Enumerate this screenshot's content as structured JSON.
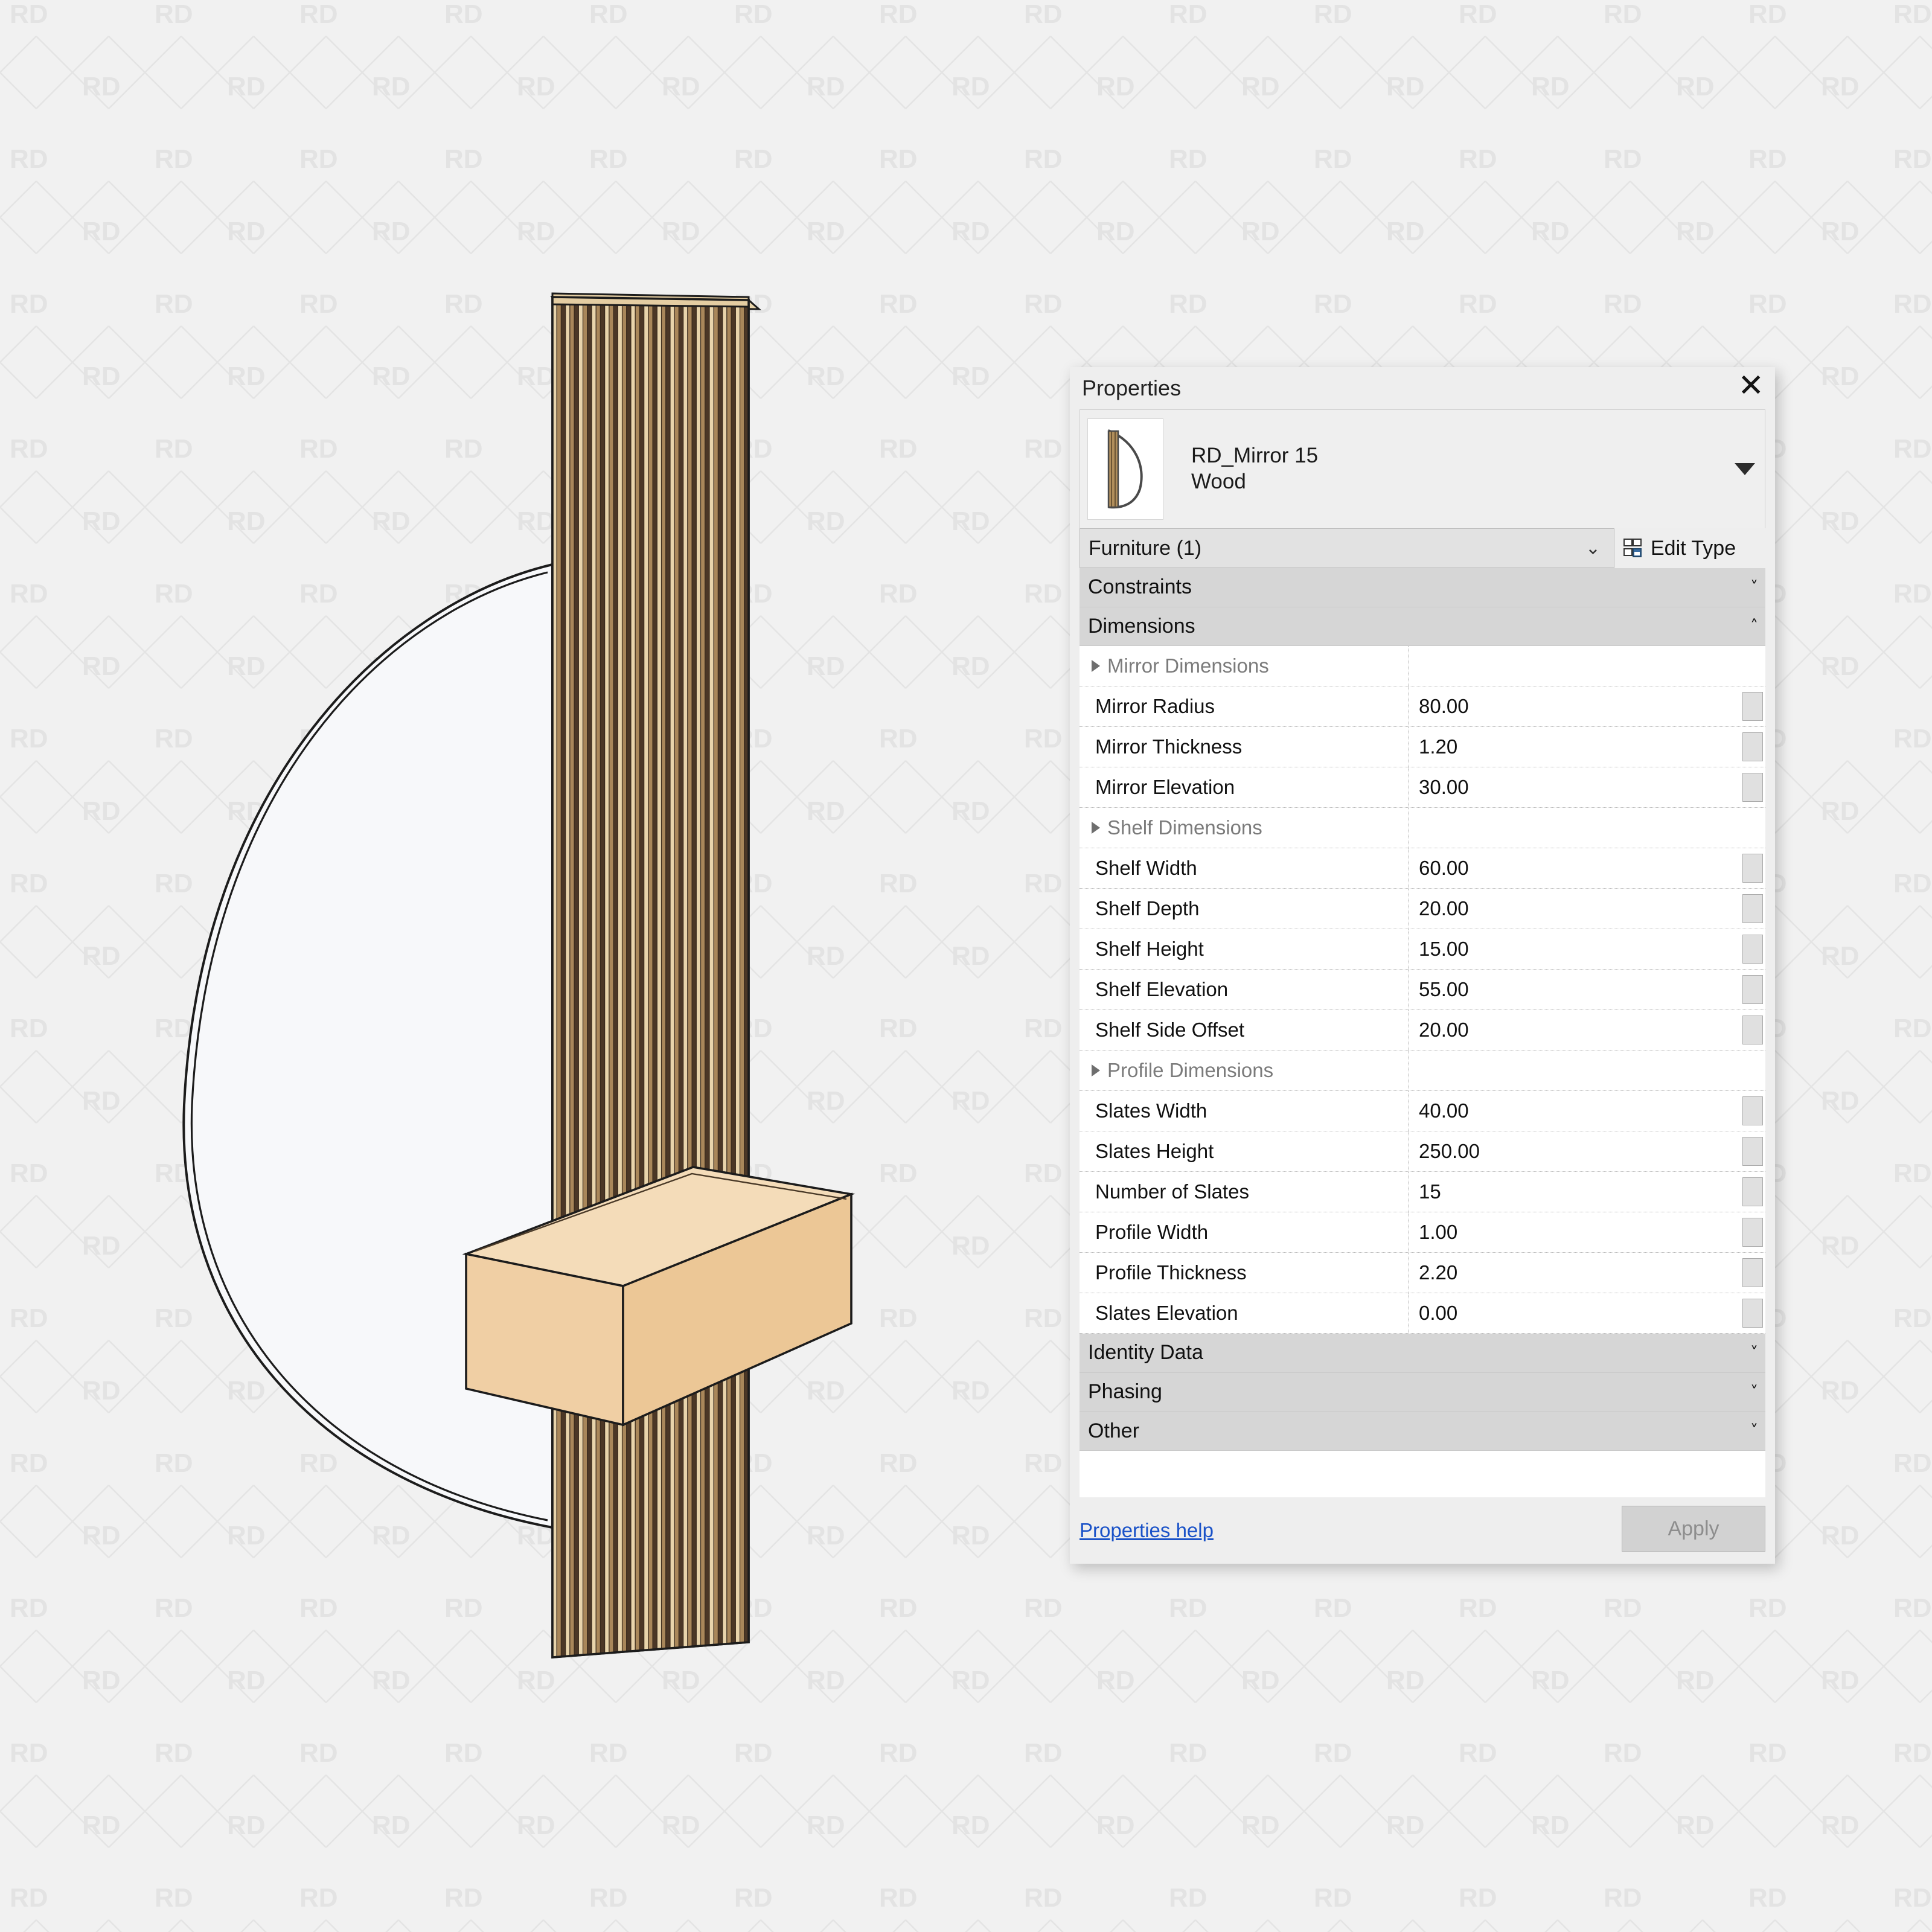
{
  "watermark": {
    "text": "RD"
  },
  "palette": {
    "title": "Properties",
    "close_icon": "close-icon",
    "type_name_line1": "RD_Mirror 15",
    "type_name_line2": "Wood",
    "family_selector_value": "Furniture (1)",
    "edit_type_label": "Edit Type",
    "edit_type_icon": "edit-type-icon",
    "sections": [
      {
        "label": "Constraints",
        "state": "collapsed",
        "chevron": "chevron-double-down-icon"
      },
      {
        "label": "Dimensions",
        "state": "expanded",
        "chevron": "chevron-double-up-icon"
      }
    ],
    "parameters": [
      {
        "name": "Mirror Dimensions",
        "value": "",
        "group": true
      },
      {
        "name": "Mirror Radius",
        "value": "80.00"
      },
      {
        "name": "Mirror Thickness",
        "value": "1.20"
      },
      {
        "name": "Mirror Elevation",
        "value": "30.00"
      },
      {
        "name": "Shelf Dimensions",
        "value": "",
        "group": true
      },
      {
        "name": "Shelf Width",
        "value": "60.00"
      },
      {
        "name": "Shelf Depth",
        "value": "20.00"
      },
      {
        "name": "Shelf Height",
        "value": "15.00"
      },
      {
        "name": "Shelf Elevation",
        "value": "55.00"
      },
      {
        "name": "Shelf Side Offset",
        "value": "20.00"
      },
      {
        "name": "Profile Dimensions",
        "value": "",
        "group": true
      },
      {
        "name": "Slates Width",
        "value": "40.00"
      },
      {
        "name": "Slates Height",
        "value": "250.00"
      },
      {
        "name": "Number of Slates",
        "value": "15"
      },
      {
        "name": "Profile Width",
        "value": "1.00"
      },
      {
        "name": "Profile Thickness",
        "value": "2.20"
      },
      {
        "name": "Slates Elevation",
        "value": "0.00"
      }
    ],
    "bottom_sections": [
      {
        "label": "Identity Data",
        "state": "collapsed",
        "chevron": "chevron-double-down-icon"
      },
      {
        "label": "Phasing",
        "state": "collapsed",
        "chevron": "chevron-double-down-icon"
      },
      {
        "label": "Other",
        "state": "collapsed",
        "chevron": "chevron-double-down-icon"
      }
    ],
    "help_link_label": "Properties help",
    "apply_button_label": "Apply"
  },
  "model": {
    "description": "Isometric wood slat mirror panel with shelf",
    "slat_count": 15,
    "colors": {
      "wood_light": "#e8d4ab",
      "wood_mid": "#a9875a",
      "wood_dark": "#4b3726",
      "shelf_face": "#f0cfa4",
      "shelf_top": "#f2d7b0",
      "shelf_side": "#e9c390",
      "mirror_fill": "#f7f8fa",
      "outline": "#1c1c1c"
    }
  }
}
